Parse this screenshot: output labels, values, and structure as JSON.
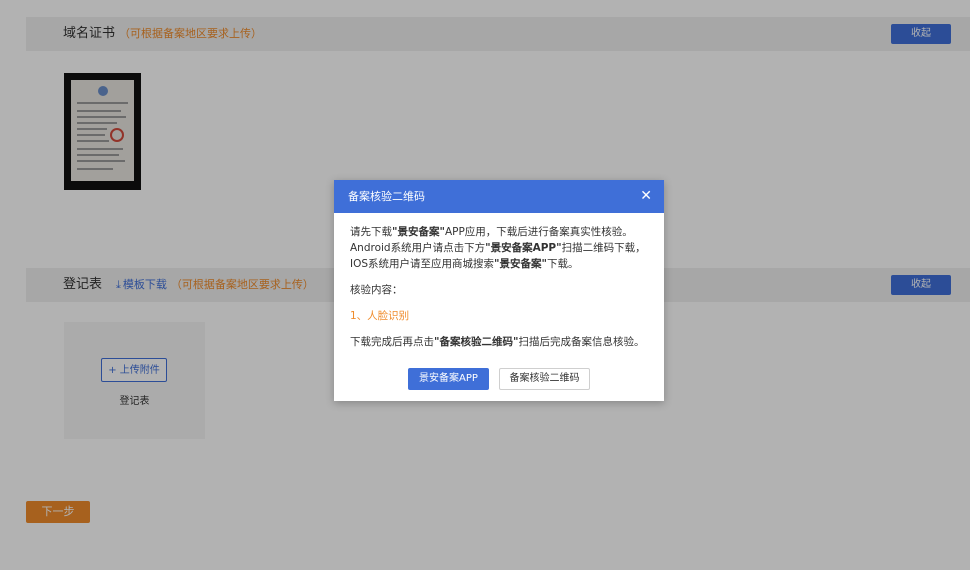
{
  "domain_cert_section": {
    "title": "域名证书",
    "note": "（可根据备案地区要求上传）",
    "collapse_label": "收起"
  },
  "register_section": {
    "title": "登记表",
    "template_download": "模板下载",
    "note": "（可根据备案地区要求上传）",
    "collapse_label": "收起",
    "upload_button": "+ 上传附件",
    "upload_label": "登记表"
  },
  "next_button": "下一步",
  "modal": {
    "title": "备案核验二维码",
    "close_glyph": "✕",
    "para1": {
      "t1": "请先下载",
      "b1": "\"景安备案\"",
      "t2": "APP应用，下载后进行备案真实性核验。"
    },
    "para2": {
      "t1": "Android系统用户请点击下方",
      "b1": "\"景安备案APP\"",
      "t2": "扫描二维码下载，"
    },
    "para3": {
      "t1": "IOS系统用户请至应用商城搜索",
      "b1": "\"景安备案\"",
      "t2": "下载。"
    },
    "verify_label": "核验内容：",
    "verify_item": "1、人脸识别",
    "finish": {
      "t1": "下载完成后再点击",
      "b1": "\"备案核验二维码\"",
      "t2": "扫描后完成备案信息核验。"
    },
    "primary_button": "景安备案APP",
    "secondary_button": "备案核验二维码"
  },
  "colors": {
    "primary": "#3f6fd8",
    "accent": "#f08c2c"
  },
  "icons": {
    "download": "download-icon",
    "close": "close-icon"
  }
}
